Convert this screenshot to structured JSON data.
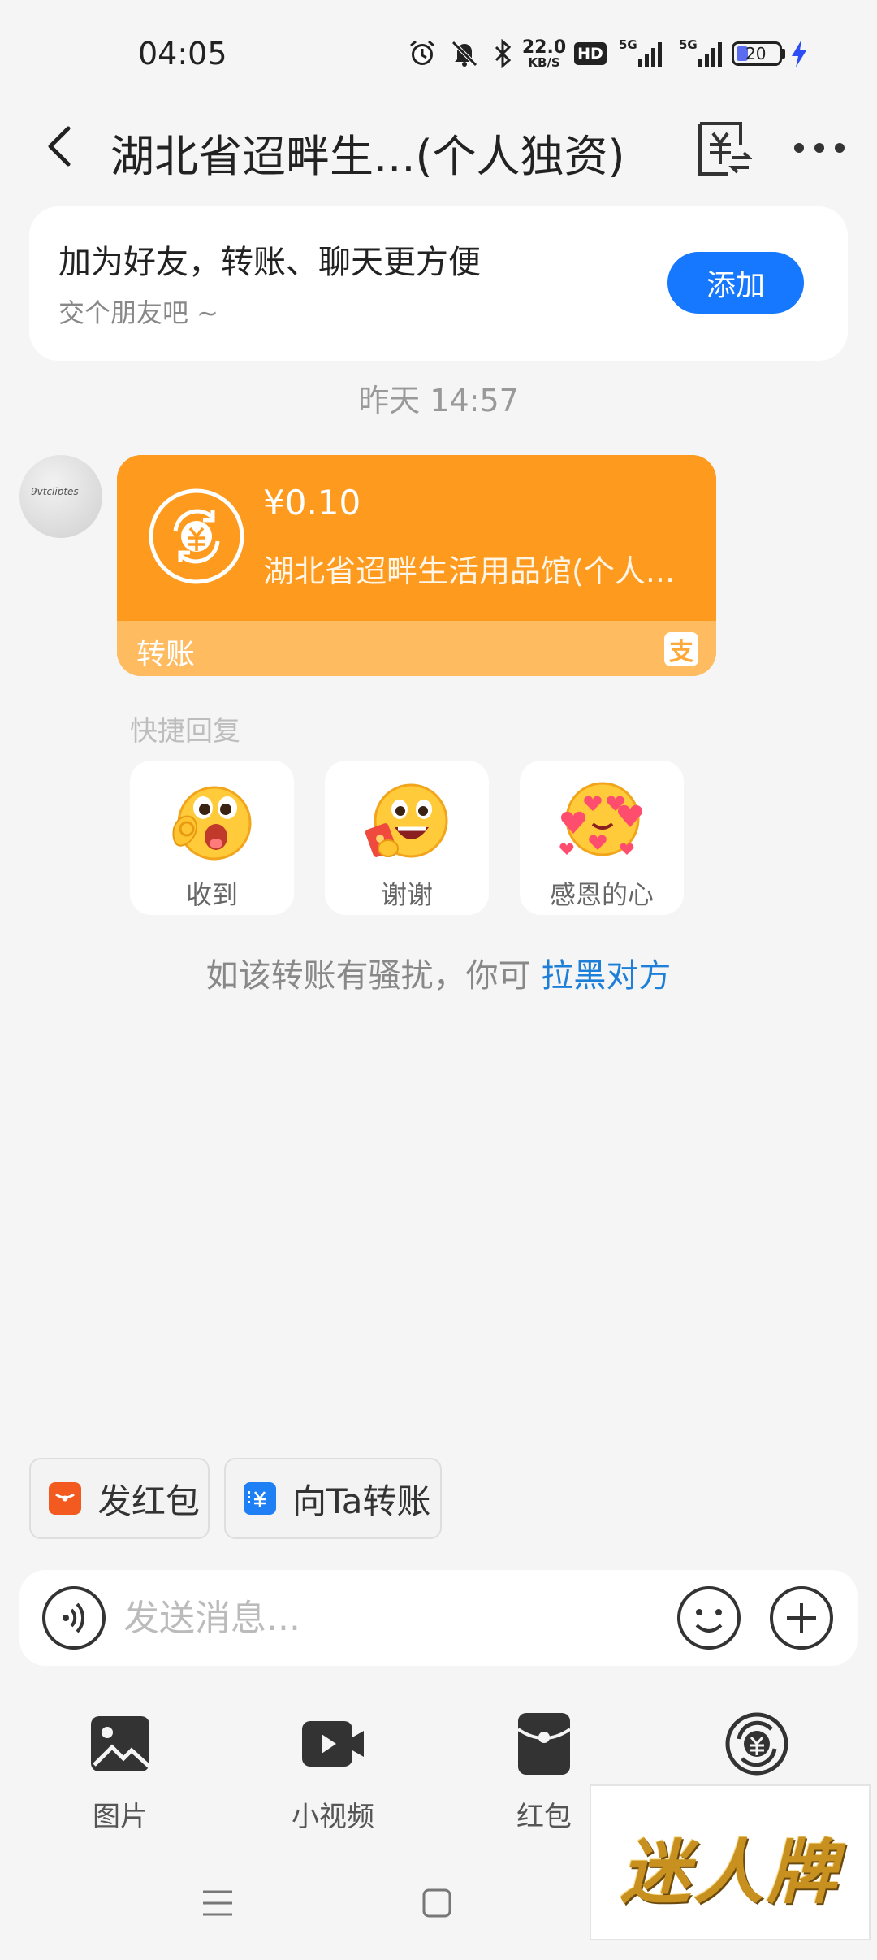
{
  "status_bar": {
    "time": "04:05",
    "net_speed_value": "22.0",
    "net_speed_unit": "KB/S",
    "hd_badge": "HD",
    "signal1_label": "5G",
    "signal2_label": "5G",
    "battery": "20",
    "icons": [
      "alarm-icon",
      "mute-icon",
      "bluetooth-icon",
      "hd-icon",
      "signal-icon",
      "signal-icon",
      "battery-icon",
      "charging-icon"
    ]
  },
  "nav": {
    "title": "湖北省迢畔生...(个人独资)",
    "back_icon": "chevron-left-icon",
    "bill_icon": "bill-icon",
    "more_icon": "more-icon"
  },
  "friend_banner": {
    "title": "加为好友，转账、聊天更方便",
    "subtitle": "交个朋友吧 ~",
    "button": "添加"
  },
  "timestamp": "昨天 14:57",
  "message": {
    "avatar_text": "9vtcliptes",
    "amount": "¥0.10",
    "payee": "湖北省迢畔生活用品馆(个人...",
    "label": "转账",
    "alipay_mark": "支",
    "colors": {
      "card": "#fe9b1e",
      "footer": "#ffbb5f"
    }
  },
  "quick_reply": {
    "title": "快捷回复",
    "items": [
      {
        "label": "收到",
        "icon": "ok-emoji-icon"
      },
      {
        "label": "谢谢",
        "icon": "thanks-emoji-icon"
      },
      {
        "label": "感恩的心",
        "icon": "heart-emoji-icon"
      }
    ]
  },
  "block_notice": {
    "text": "如该转账有骚扰，你可 ",
    "link": "拉黑对方"
  },
  "shortcuts": {
    "red_packet": "发红包",
    "transfer": "向Ta转账"
  },
  "input": {
    "placeholder": "发送消息..."
  },
  "tools": [
    {
      "label": "图片",
      "icon": "image-icon"
    },
    {
      "label": "小视频",
      "icon": "video-icon"
    },
    {
      "label": "红包",
      "icon": "red-packet-icon"
    },
    {
      "label": "",
      "icon": "transfer-icon"
    }
  ],
  "watermark": "迷人牌",
  "accent_color": "#1677ff"
}
